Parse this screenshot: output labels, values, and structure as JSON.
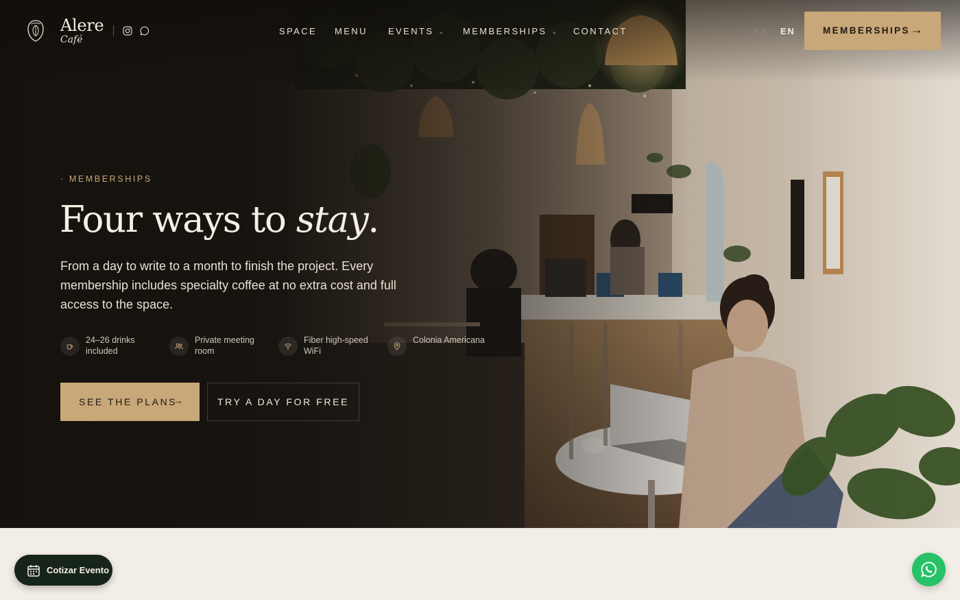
{
  "brand": {
    "name": "Alere",
    "sub": "Café"
  },
  "header": {
    "social": [
      "instagram-icon",
      "whatsapp-icon"
    ],
    "nav": [
      {
        "label": "SPACE",
        "has_dropdown": false
      },
      {
        "label": "MENU",
        "has_dropdown": false
      },
      {
        "label": "EVENTS",
        "has_dropdown": true
      },
      {
        "label": "MEMBERSHIPS",
        "has_dropdown": true
      },
      {
        "label": "CONTACT",
        "has_dropdown": false
      }
    ],
    "lang": {
      "es": "ES",
      "separator": "·",
      "en": "EN",
      "active": "EN"
    },
    "cta": {
      "label": "MEMBERSHIPS",
      "arrow": "→"
    }
  },
  "hero": {
    "eyebrow": "· MEMBERSHIPS",
    "headline_prefix": "Four ways to ",
    "headline_italic": "stay",
    "headline_suffix": ".",
    "lede": "From a day to write to a month to finish the project. Every membership includes specialty coffee at no extra cost and full access to the space.",
    "features": [
      {
        "icon": "coffee-cup-icon",
        "text": "24–26 drinks included"
      },
      {
        "icon": "people-icon",
        "text": "Private meeting room"
      },
      {
        "icon": "wifi-icon",
        "text": "Fiber high-speed WiFi"
      },
      {
        "icon": "location-pin-icon",
        "text": "Colonia Americana"
      }
    ],
    "primary_button": {
      "label": "SEE THE PLANS",
      "arrow": "→"
    },
    "secondary_button": {
      "label": "TRY A DAY FOR FREE"
    }
  },
  "floating": {
    "quote_button": "Cotizar Evento",
    "whatsapp": "whatsapp-icon"
  },
  "colors": {
    "accent": "#c8a878",
    "hero_dark": "#1c1813",
    "page_bg": "#f2ede6",
    "whatsapp_green": "#27c267",
    "quote_button_bg": "#17241a"
  }
}
